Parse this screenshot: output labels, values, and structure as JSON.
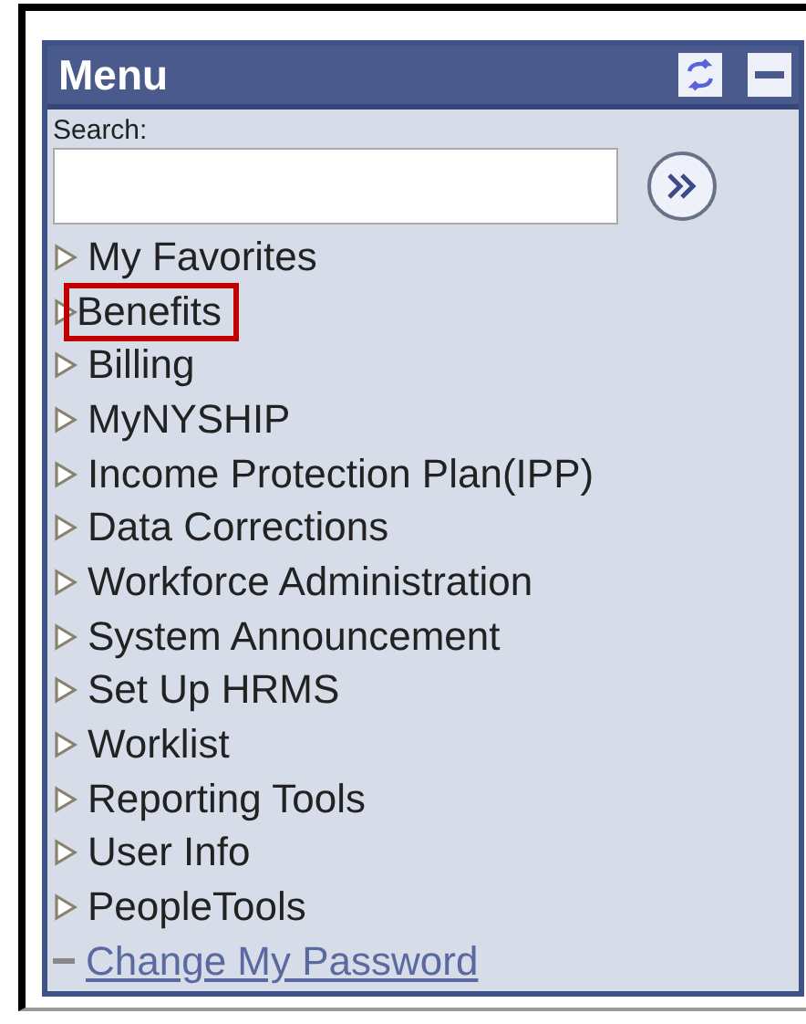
{
  "menu": {
    "title": "Menu",
    "search": {
      "label": "Search:"
    },
    "items": [
      {
        "label": "My Favorites",
        "kind": "folder",
        "highlighted": false
      },
      {
        "label": "Benefits",
        "kind": "folder",
        "highlighted": true
      },
      {
        "label": "Billing",
        "kind": "folder",
        "highlighted": false
      },
      {
        "label": "MyNYSHIP",
        "kind": "folder",
        "highlighted": false
      },
      {
        "label": "Income Protection Plan(IPP)",
        "kind": "folder",
        "highlighted": false
      },
      {
        "label": "Data Corrections",
        "kind": "folder",
        "highlighted": false
      },
      {
        "label": "Workforce Administration",
        "kind": "folder",
        "highlighted": false
      },
      {
        "label": "System Announcement",
        "kind": "folder",
        "highlighted": false
      },
      {
        "label": "Set Up HRMS",
        "kind": "folder",
        "highlighted": false
      },
      {
        "label": "Worklist",
        "kind": "folder",
        "highlighted": false
      },
      {
        "label": "Reporting Tools",
        "kind": "folder",
        "highlighted": false
      },
      {
        "label": "User Info",
        "kind": "folder",
        "highlighted": false
      },
      {
        "label": "PeopleTools",
        "kind": "folder",
        "highlighted": false
      },
      {
        "label": "Change My Password",
        "kind": "link",
        "highlighted": false
      }
    ]
  }
}
